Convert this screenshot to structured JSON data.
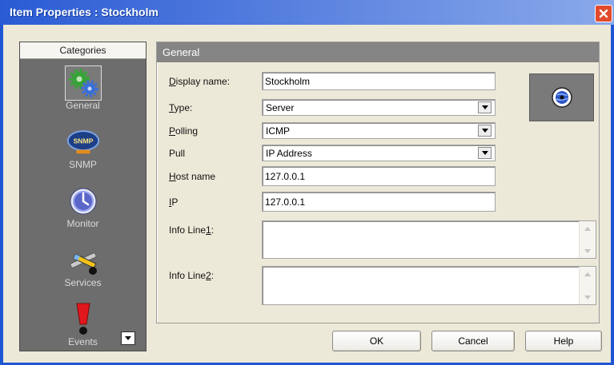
{
  "window": {
    "title": "Item Properties : Stockholm",
    "close_icon": "close-icon"
  },
  "colors": {
    "title_bar_start": "#2a5bd4",
    "title_bar_end": "#8aa9ea",
    "frame": "#1f56d4",
    "dialog_bg": "#ece9d8",
    "sidebar_bg": "#6d6d6d",
    "panel_header": "#858585",
    "close_button": "#e14a2c"
  },
  "sidebar": {
    "header": "Categories",
    "items": [
      {
        "label": "General",
        "icon": "general-gears-icon",
        "selected": true
      },
      {
        "label": "SNMP",
        "icon": "snmp-badge-icon",
        "badge": "SNMP",
        "selected": false
      },
      {
        "label": "Monitor",
        "icon": "monitor-clock-icon",
        "selected": false
      },
      {
        "label": "Services",
        "icon": "services-tools-icon",
        "selected": false
      },
      {
        "label": "Events",
        "icon": "events-exclamation-icon",
        "selected": false
      }
    ],
    "scroll_icon": "chevron-down-icon"
  },
  "panel": {
    "header": "General",
    "preview_icon": "server-globe-icon",
    "fields": {
      "display_name": {
        "label": "Display name:",
        "mnemonic": "D",
        "value": "Stockholm"
      },
      "type": {
        "label": "Type:",
        "mnemonic": "T",
        "value": "Server"
      },
      "polling": {
        "label": "Polling",
        "mnemonic": "P",
        "value": "ICMP"
      },
      "pull": {
        "label": "Pull",
        "value": "IP Address"
      },
      "host_name": {
        "label": "Host name",
        "mnemonic": "H",
        "value": "127.0.0.1"
      },
      "ip": {
        "label": "IP",
        "mnemonic": "I",
        "value": "127.0.0.1"
      },
      "info_line1": {
        "label": "Info Line1:",
        "mnemonic": "1",
        "value": ""
      },
      "info_line2": {
        "label": "Info Line2:",
        "mnemonic": "2",
        "value": ""
      }
    }
  },
  "buttons": {
    "ok": "OK",
    "cancel": "Cancel",
    "help": "Help"
  }
}
